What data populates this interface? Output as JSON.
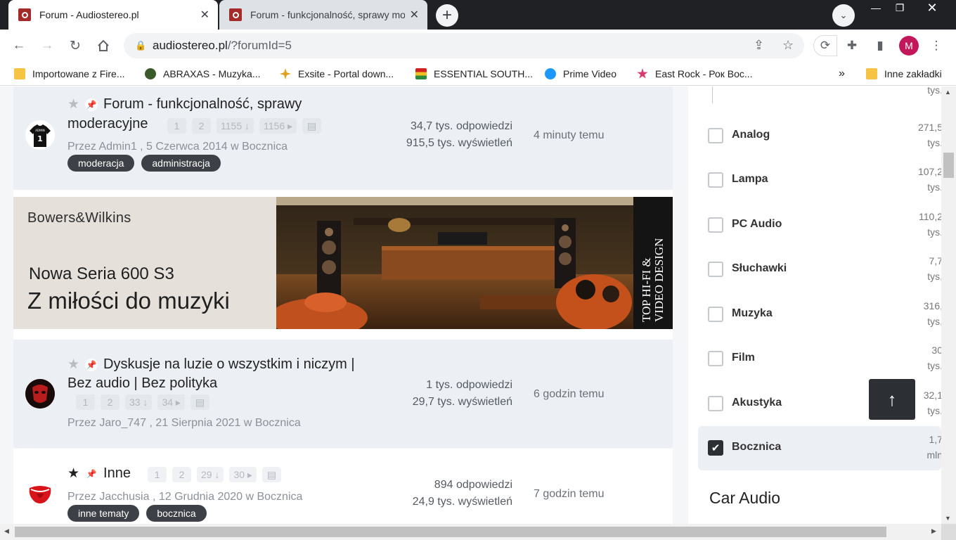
{
  "browser": {
    "tabs": [
      {
        "title": "Forum - Audiostereo.pl",
        "active": true
      },
      {
        "title": "Forum - funkcjonalność, sprawy mod",
        "active": false
      }
    ],
    "new_tab": "+",
    "close_glyph": "✕",
    "url_host": "audiostereo.pl",
    "url_path": "/?forumId=5",
    "profile_initial": "M",
    "bookmarks": [
      {
        "label": "Importowane z Fire...",
        "icon": "folder-icon",
        "color": "#f6c343"
      },
      {
        "label": "ABRAXAS - Muzyka...",
        "icon": "abraxas-icon",
        "color": "#3b5a2a"
      },
      {
        "label": "Exsite - Portal down...",
        "icon": "exsite-icon",
        "color": "#e0a020"
      },
      {
        "label": "ESSENTIAL SOUTH...",
        "icon": "flag-icon",
        "color": "#2a8a3a"
      },
      {
        "label": "Prime Video",
        "icon": "play-icon",
        "color": "#1a98ff"
      },
      {
        "label": "East Rock - Рок Вос...",
        "icon": "star-icon",
        "color": "#d93a6a"
      }
    ],
    "bookmarks_more": "»",
    "other_bookmarks": "Inne zakładki"
  },
  "topics": [
    {
      "title_line1": "Forum - funkcjonalność, sprawy",
      "title_line2": "moderacyjne",
      "pages": [
        "1",
        "2",
        "1155 ↓",
        "1156 ▸"
      ],
      "meta": "Przez Admin1 , 5 Czerwca 2014 w Bocznica",
      "tags": [
        "moderacja",
        "administracja"
      ],
      "replies": "34,7 tys. odpowiedzi",
      "views": "915,5 tys. wyświetleń",
      "last_post": "4 minuty temu",
      "avatar_text": "1",
      "avatar_small_text": "ADMIN",
      "starred": false
    },
    {
      "title_line1": "Dyskusje na luzie o wszystkim i niczym |",
      "title_line2": "Bez audio | Bez polityka",
      "pages": [
        "1",
        "2",
        "33 ↓",
        "34 ▸"
      ],
      "meta": "Przez Jaro_747 , 21 Sierpnia 2021 w Bocznica",
      "replies": "1 tys. odpowiedzi",
      "views": "29,7 tys. wyświetleń",
      "last_post": "6 godzin temu",
      "starred": false
    },
    {
      "title_line1": "Inne",
      "pages": [
        "1",
        "2",
        "29 ↓",
        "30 ▸"
      ],
      "meta": "Przez Jacchusia , 12 Grudnia 2020 w Bocznica",
      "tags": [
        "inne tematy",
        "bocznica"
      ],
      "replies": "894 odpowiedzi",
      "views": "24,9 tys. wyświetleń",
      "last_post": "7 godzin temu",
      "starred": true
    }
  ],
  "banner": {
    "brand": "Bowers&Wilkins",
    "series": "Nowa Seria 600 S3",
    "slogan": "Z miłości do muzyki",
    "side_line1": "TOP HI-FI &",
    "side_line2": "VIDEO DESIGN"
  },
  "sidebar": {
    "top_count": "tys.",
    "categories": [
      {
        "label": "Analog",
        "count_line1": "271,5",
        "count_line2": "tys.",
        "checked": false
      },
      {
        "label": "Lampa",
        "count_line1": "107,2",
        "count_line2": "tys.",
        "checked": false
      },
      {
        "label": "PC Audio",
        "count_line1": "110,2",
        "count_line2": "tys.",
        "checked": false
      },
      {
        "label": "Słuchawki",
        "count_line1": "7,7",
        "count_line2": "tys.",
        "checked": false
      },
      {
        "label": "Muzyka",
        "count_line1": "316,",
        "count_line2": "tys.",
        "checked": false
      },
      {
        "label": "Film",
        "count_line1": "30",
        "count_line2": "tys.",
        "checked": false
      },
      {
        "label": "Akustyka",
        "count_line1": "32,1",
        "count_line2": "tys.",
        "checked": false
      },
      {
        "label": "Bocznica",
        "count_line1": "1,7",
        "count_line2": "mln",
        "checked": true
      }
    ],
    "section_heading": "Car Audio"
  },
  "back_to_top": "↑",
  "colors": {
    "pinned_row": "#eceff4",
    "tag_bg": "#3d4046",
    "pin_green": "#3aa25a",
    "favicon_red": "#a52a2a"
  }
}
